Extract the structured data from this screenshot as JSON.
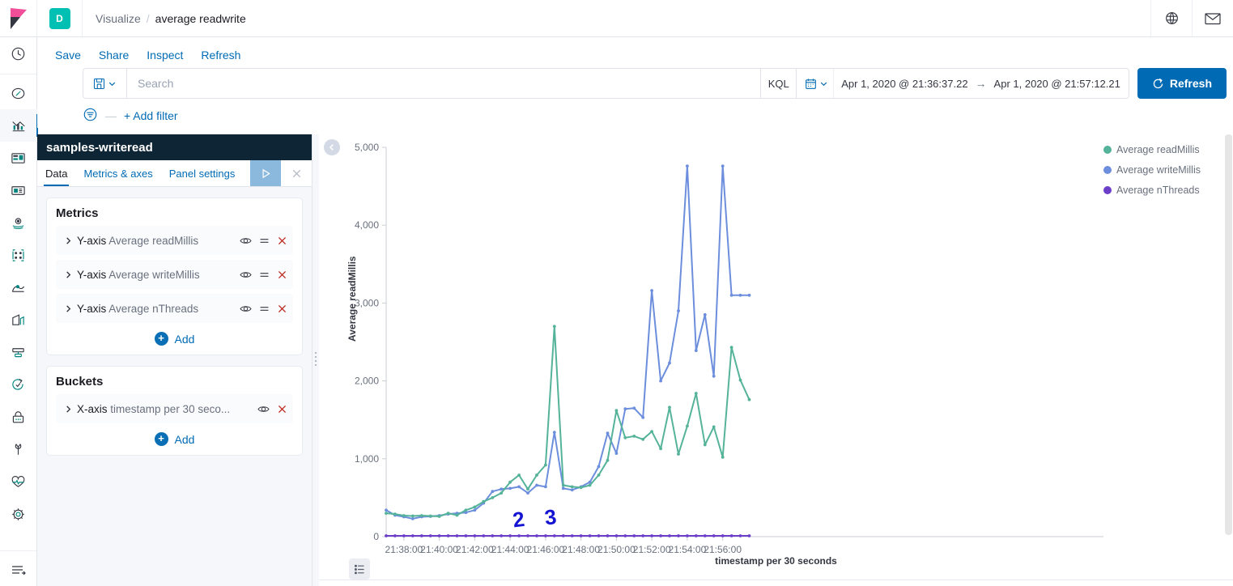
{
  "header": {
    "logo_icon": "kibana-logo",
    "space_badge": "D",
    "breadcrumb": {
      "parent": "Visualize",
      "separator": "/",
      "current": "average readwrite"
    },
    "help_icon": "globe-help-icon",
    "news_icon": "envelope-news-icon"
  },
  "sidebar": {
    "items": [
      {
        "icon": "clock-icon",
        "name": "recently-viewed"
      },
      {
        "icon": "compass-icon",
        "name": "discover"
      },
      {
        "icon": "bar-chart-icon",
        "name": "visualize",
        "active": true
      },
      {
        "icon": "dashboard-icon",
        "name": "dashboard"
      },
      {
        "icon": "canvas-icon",
        "name": "canvas"
      },
      {
        "icon": "map-pin-icon",
        "name": "maps"
      },
      {
        "icon": "graph-nodes-icon",
        "name": "graph"
      },
      {
        "icon": "machine-learning-icon",
        "name": "machine-learning"
      },
      {
        "icon": "apm-icon",
        "name": "apm"
      },
      {
        "icon": "infrastructure-icon",
        "name": "infrastructure"
      },
      {
        "icon": "uptime-icon",
        "name": "uptime"
      },
      {
        "icon": "lock-icon",
        "name": "siem"
      },
      {
        "icon": "wrench-icon",
        "name": "dev-tools"
      },
      {
        "icon": "heartbeat-icon",
        "name": "monitoring"
      },
      {
        "icon": "gear-icon",
        "name": "management"
      }
    ],
    "collapse_icon": "collapse-nav-icon"
  },
  "toolbar": {
    "actions": [
      "Save",
      "Share",
      "Inspect",
      "Refresh"
    ],
    "saved_query_icon": "save-disk-icon",
    "saved_query_chevron": "chevron-down-icon",
    "search": {
      "placeholder": "Search",
      "value": ""
    },
    "query_language": "KQL",
    "calendar_icon": "calendar-icon",
    "calendar_chevron": "chevron-down-icon",
    "date_start": "Apr 1, 2020 @ 21:36:37.22",
    "date_arrow": "→",
    "date_end": "Apr 1, 2020 @ 21:57:12.21",
    "refresh_label": "Refresh",
    "refresh_icon": "refresh-icon",
    "filter_icon": "filter-icon",
    "filter_dash": "—",
    "add_filter_label": "+ Add filter"
  },
  "editor": {
    "title": "samples-writeread",
    "tabs": [
      {
        "label": "Data",
        "active": true
      },
      {
        "label": "Metrics & axes",
        "active": false
      },
      {
        "label": "Panel settings",
        "active": false
      }
    ],
    "apply_icon": "play-apply-icon",
    "close_icon": "close-icon",
    "metrics": {
      "heading": "Metrics",
      "rows": [
        {
          "axis": "Y-axis",
          "field": "Average readMillis",
          "expand_icon": "chevron-right-icon",
          "eye_icon": "eye-icon",
          "drag_icon": "drag-handle-icon",
          "remove_icon": "remove-x-icon"
        },
        {
          "axis": "Y-axis",
          "field": "Average writeMillis",
          "expand_icon": "chevron-right-icon",
          "eye_icon": "eye-icon",
          "drag_icon": "drag-handle-icon",
          "remove_icon": "remove-x-icon"
        },
        {
          "axis": "Y-axis",
          "field": "Average nThreads",
          "expand_icon": "chevron-right-icon",
          "eye_icon": "eye-icon",
          "drag_icon": "drag-handle-icon",
          "remove_icon": "remove-x-icon"
        }
      ],
      "add_label": "Add",
      "add_icon": "plus-circle-icon"
    },
    "buckets": {
      "heading": "Buckets",
      "rows": [
        {
          "axis": "X-axis",
          "field": "timestamp per 30 seco...",
          "expand_icon": "chevron-right-icon",
          "eye_icon": "eye-icon",
          "remove_icon": "remove-x-icon"
        }
      ],
      "add_label": "Add",
      "add_icon": "plus-circle-icon"
    },
    "resize_handle_icon": "resize-grip-icon"
  },
  "visualization": {
    "collapse_icon": "chevron-left-icon",
    "table_toggle_icon": "list-table-icon",
    "scrollbar": "vertical-scrollbar"
  },
  "colors": {
    "readMillis": "#54B399",
    "writeMillis": "#6C8EDC",
    "nThreads": "#6C3FCA",
    "accent": "#006BB4",
    "editor_title_bg": "#0d2535",
    "annotation": "#1414d2"
  },
  "chart_data": {
    "type": "line",
    "title": "",
    "xlabel": "timestamp per 30 seconds",
    "ylabel": "Average readMillis",
    "ylim": [
      0,
      5000
    ],
    "yticks": [
      "0",
      "1,000",
      "2,000",
      "3,000",
      "4,000",
      "5,000"
    ],
    "ytick_values": [
      0,
      1000,
      2000,
      3000,
      4000,
      5000
    ],
    "xticks": [
      "21:38:00",
      "21:40:00",
      "21:42:00",
      "21:44:00",
      "21:46:00",
      "21:48:00",
      "21:50:00",
      "21:52:00",
      "21:54:00",
      "21:56:00"
    ],
    "xtick_values": [
      21.6333,
      21.6667,
      21.7,
      21.7333,
      21.7667,
      21.8,
      21.8333,
      21.8667,
      21.9,
      21.9333
    ],
    "x_start_minutes": 2197.0,
    "x_end_minutes": 2237.5,
    "grid": false,
    "legend_position": "right",
    "legend": [
      "Average readMillis",
      "Average writeMillis",
      "Average nThreads"
    ],
    "x": [
      2197.0,
      2197.5,
      2198.0,
      2198.5,
      2199.0,
      2199.5,
      2200.0,
      2200.5,
      2201.0,
      2201.5,
      2202.0,
      2202.5,
      2203.0,
      2203.5,
      2204.0,
      2204.5,
      2205.0,
      2205.5,
      2206.0,
      2206.5,
      2207.0,
      2207.5,
      2208.0,
      2208.5,
      2209.0,
      2209.5,
      2210.0,
      2210.5,
      2211.0,
      2211.5,
      2212.0,
      2212.5,
      2213.0,
      2213.5,
      2214.0,
      2214.5,
      2215.0,
      2215.5,
      2216.0,
      2216.5,
      2217.0,
      2217.5
    ],
    "series": [
      {
        "name": "Average readMillis",
        "color": "#54B399",
        "values": [
          300,
          290,
          270,
          265,
          270,
          265,
          260,
          300,
          275,
          340,
          380,
          450,
          500,
          560,
          700,
          790,
          610,
          790,
          920,
          2700,
          660,
          640,
          630,
          660,
          790,
          980,
          1620,
          1270,
          1290,
          1250,
          1350,
          1130,
          1660,
          1060,
          1420,
          1840,
          1180,
          1410,
          1020,
          2430,
          2010,
          1760
        ]
      },
      {
        "name": "Average writeMillis",
        "color": "#6C8EDC",
        "values": [
          340,
          275,
          255,
          230,
          255,
          260,
          270,
          290,
          300,
          310,
          340,
          430,
          580,
          610,
          620,
          640,
          560,
          660,
          640,
          1340,
          620,
          600,
          640,
          700,
          900,
          1330,
          1070,
          1640,
          1650,
          1530,
          3160,
          2000,
          2230,
          2900,
          4760,
          2390,
          2850,
          2060,
          4760,
          3100,
          3100,
          3100
        ]
      },
      {
        "name": "Average nThreads",
        "color": "#6C3FCA",
        "values": [
          10,
          10,
          10,
          10,
          10,
          10,
          10,
          10,
          10,
          10,
          10,
          10,
          10,
          10,
          10,
          10,
          10,
          10,
          10,
          10,
          10,
          10,
          10,
          10,
          10,
          10,
          10,
          10,
          10,
          10,
          10,
          10,
          10,
          10,
          10,
          10,
          10,
          10,
          10,
          10,
          10,
          10
        ]
      }
    ],
    "annotations": [
      {
        "text": "2",
        "x": 2204.2,
        "y": 120,
        "color": "#1414d2",
        "style": "handwritten"
      },
      {
        "text": "3",
        "x": 2206.0,
        "y": 150,
        "color": "#1414d2",
        "style": "handwritten"
      }
    ]
  }
}
